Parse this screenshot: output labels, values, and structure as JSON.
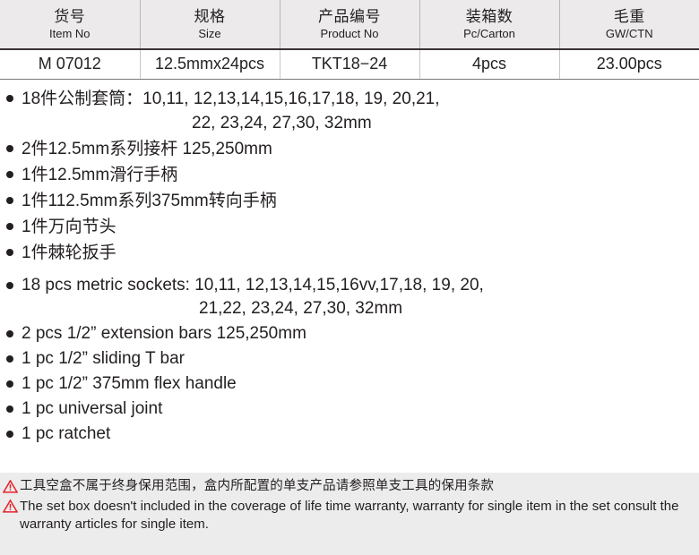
{
  "table": {
    "columns": [
      {
        "cn": "货号",
        "en": "Item No",
        "value": "M 07012"
      },
      {
        "cn": "规格",
        "en": "Size",
        "value": "12.5mmx24pcs"
      },
      {
        "cn": "产品编号",
        "en": "Product No",
        "value": "TKT18−24"
      },
      {
        "cn": "装箱数",
        "en": "Pc/Carton",
        "value": "4pcs"
      },
      {
        "cn": "毛重",
        "en": "GW/CTN",
        "value": "23.00pcs"
      }
    ]
  },
  "list_cn": [
    {
      "line1": "18件公制套筒：10,11, 12,13,14,15,16,17,18, 19, 20,21,",
      "line2": "22, 23,24, 27,30, 32mm"
    },
    {
      "line1": "2件12.5mm系列接杆 125,250mm",
      "line2": ""
    },
    {
      "line1": "1件12.5mm滑行手柄",
      "line2": ""
    },
    {
      "line1": "1件112.5mm系列375mm转向手柄",
      "line2": ""
    },
    {
      "line1": "1件万向节头",
      "line2": ""
    },
    {
      "line1": "1件棘轮扳手",
      "line2": ""
    }
  ],
  "list_en": [
    {
      "line1": "18 pcs metric sockets: 10,11, 12,13,14,15,16vv,17,18, 19, 20,",
      "line2": "21,22, 23,24, 27,30, 32mm"
    },
    {
      "line1": "2 pcs 1/2” extension bars 125,250mm",
      "line2": ""
    },
    {
      "line1": "1 pc 1/2” sliding T bar",
      "line2": ""
    },
    {
      "line1": "1 pc 1/2” 375mm flex handle",
      "line2": ""
    },
    {
      "line1": "1 pc universal joint",
      "line2": ""
    },
    {
      "line1": "1 pc ratchet",
      "line2": ""
    }
  ],
  "warnings": {
    "cn": "工具空盒不属于终身保用范围，盒内所配置的单支产品请参照单支工具的保用条款",
    "en": "The set box doesn't included in the coverage of life time warranty, warranty for single item in the set consult the warranty articles for single item.",
    "icon": "warning-triangle-icon",
    "icon_color": "#e8212a"
  },
  "colors": {
    "header_bg": "#eceaea",
    "warn_bg": "#ececec",
    "text": "#231f20",
    "rule": "#3a3335"
  }
}
